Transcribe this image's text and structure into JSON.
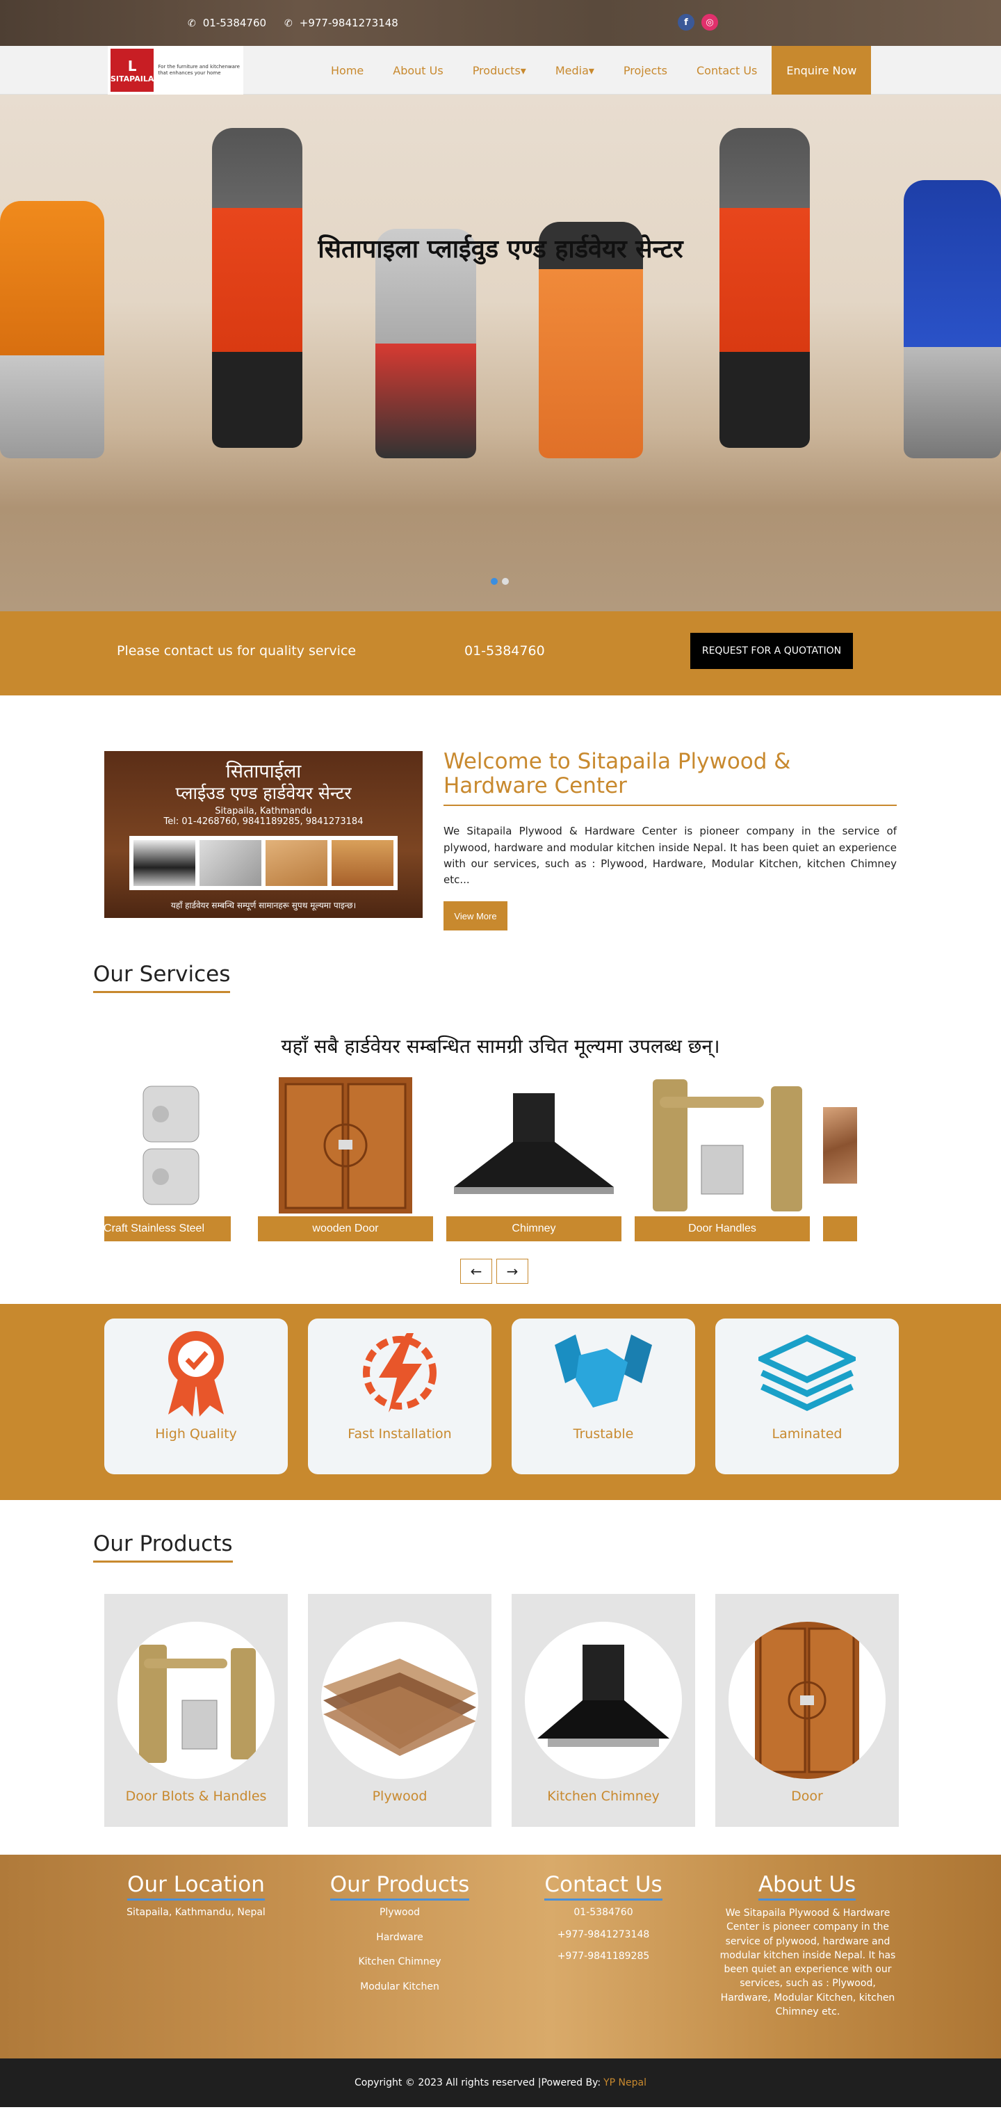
{
  "topbar": {
    "phone1": "01-5384760",
    "phone2": "+977-9841273148",
    "facebook_icon": "facebook-icon",
    "instagram_icon": "instagram-icon"
  },
  "nav": {
    "logo_text": "SITAPAILA",
    "logo_tagline": "For the furniture and kitchenware that enhances your home",
    "items": [
      {
        "label": "Home"
      },
      {
        "label": "About Us"
      },
      {
        "label": "Products▾"
      },
      {
        "label": "Media▾"
      },
      {
        "label": "Projects"
      },
      {
        "label": "Contact Us"
      }
    ],
    "enquire": "Enquire Now"
  },
  "hero": {
    "title": "सितापाइला प्लाईवुड एण्ड हार्डवेयर सेन्टर"
  },
  "cta": {
    "text": "Please contact us for quality service",
    "phone": "01-5384760",
    "button": "REQUEST FOR A QUOTATION"
  },
  "welcome": {
    "image": {
      "heading1": "सितापाईला",
      "heading2": "प्लाईउड एण्ड हार्डवेयर सेन्टर",
      "city": "Sitapaila, Kathmandu",
      "tel": "Tel: 01-4268760, 9841189285, 9841273184",
      "footer": "यहाँ हार्डवेयर सम्बन्धि सम्पूर्ण सामानहरू सुपथ मूल्यमा पाइन्छ।"
    },
    "title": "Welcome to Sitapaila Plywood & Hardware Center",
    "body": "We Sitapaila Plywood & Hardware Center is pioneer company in the service of plywood, hardware and modular kitchen inside Nepal. It has been quiet an experience with our services, such as : Plywood, Hardware, Modular Kitchen, kitchen Chimney etc...",
    "button": "View More"
  },
  "services": {
    "title": "Our Services",
    "subtitle": "यहाँ सबै हार्डवेयर सम्बन्धित सामग्री उचित मूल्यमा उपलब्ध छन्।",
    "cards": [
      {
        "label": "Craft Stainless Steel"
      },
      {
        "label": "wooden Door"
      },
      {
        "label": "Chimney"
      },
      {
        "label": "Door Handles"
      },
      {
        "label": ""
      }
    ]
  },
  "features": [
    {
      "name": "High Quality",
      "icon": "quality-badge-icon"
    },
    {
      "name": "Fast Installation",
      "icon": "lightning-gear-icon"
    },
    {
      "name": "Trustable",
      "icon": "handshake-icon"
    },
    {
      "name": "Laminated",
      "icon": "layers-icon"
    }
  ],
  "products": {
    "title": "Our Products",
    "items": [
      {
        "name": "Door Blots & Handles"
      },
      {
        "name": "Plywood"
      },
      {
        "name": "Kitchen Chimney"
      },
      {
        "name": "Door"
      }
    ]
  },
  "footer": {
    "location": {
      "title": "Our Location",
      "text": "Sitapaila, Kathmandu, Nepal"
    },
    "products": {
      "title": "Our Products",
      "items": [
        "Plywood",
        "Hardware",
        "Kitchen Chimney",
        "Modular Kitchen"
      ]
    },
    "contact": {
      "title": "Contact Us",
      "items": [
        "01-5384760",
        "+977-9841273148",
        "+977-9841189285"
      ]
    },
    "about": {
      "title": "About Us",
      "text": "We Sitapaila Plywood & Hardware Center is pioneer company in the service of plywood, hardware and modular kitchen inside Nepal. It has been quiet an experience with our services, such as : Plywood, Hardware, Modular Kitchen, kitchen Chimney etc."
    }
  },
  "copyright": {
    "text": "Copyright © 2023 All rights reserved |Powered By:",
    "brand": "YP Nepal"
  },
  "colors": {
    "accent": "#c8892e",
    "dark": "#1f1f1f",
    "blue": "#3a8ee0"
  }
}
